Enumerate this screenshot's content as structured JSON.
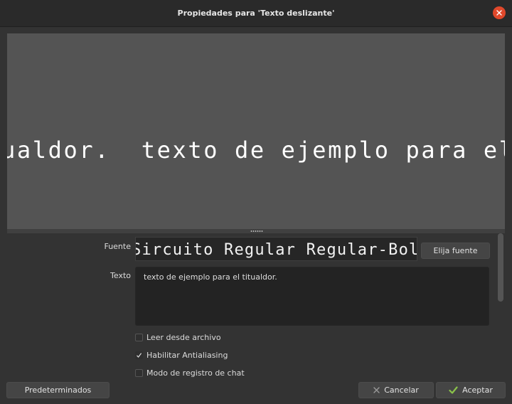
{
  "window": {
    "title": "Propiedades para 'Texto deslizante'"
  },
  "preview": {
    "scrolling_text": "ualdor.  texto de ejemplo para el titualdor."
  },
  "font": {
    "label": "Fuente",
    "display": "Sircuito Regular Regular-Bold",
    "choose_button": "Elija fuente"
  },
  "text": {
    "label": "Texto",
    "value": "texto de ejemplo para el titualdor."
  },
  "options": [
    {
      "label": "Leer desde archivo",
      "checked": false
    },
    {
      "label": "Habilitar Antialiasing",
      "checked": true
    },
    {
      "label": "Modo de registro de chat",
      "checked": false
    }
  ],
  "footer": {
    "defaults_button": "Predeterminados",
    "cancel_button": "Cancelar",
    "accept_button": "Aceptar"
  },
  "icons": {
    "close": "close-icon",
    "cancel": "x-icon",
    "accept": "checkmark-icon"
  },
  "colors": {
    "close_button": "#e0482b",
    "accept_check": "#8bc34a",
    "preview_background": "#545454"
  }
}
